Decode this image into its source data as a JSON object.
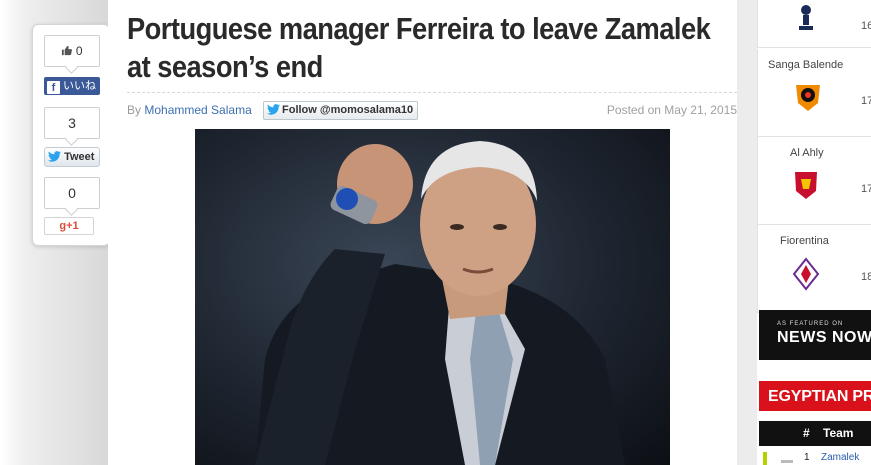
{
  "share": {
    "like_count": "0",
    "facebook_label": "いいね",
    "tweet_count": "3",
    "tweet_label": "Tweet",
    "gplus_count": "0",
    "gplus_label": "+1"
  },
  "article": {
    "title": "Portuguese manager Ferreira to leave Zamalek at season’s end",
    "by_label": "By",
    "author": "Mohammed Salama",
    "follow_label": "Follow @momosalama10",
    "posted": "Posted on May 21, 2015"
  },
  "sidebar": {
    "fixtures": [
      {
        "team": "",
        "time": "16",
        "logo": "tottenham-crest-icon"
      },
      {
        "team": "Sanga Balende",
        "time": "17",
        "logo": "sanga-balende-crest-icon"
      },
      {
        "team": "Al Ahly",
        "time": "17",
        "logo": "al-ahly-crest-icon"
      },
      {
        "team": "Fiorentina",
        "time": "18",
        "logo": "fiorentina-crest-icon"
      }
    ],
    "news_small": "AS FEATURED ON",
    "news_big": "NEWS NOW",
    "league_title": "EGYPTIAN PREMIER",
    "table_headers": {
      "num": "#",
      "team": "Team"
    },
    "table_rows": [
      {
        "num": "1",
        "team": "Zamalek"
      }
    ]
  },
  "colors": {
    "accent_red": "#d9111a",
    "link_blue": "#3c6fb0",
    "facebook_blue": "#3b5998"
  }
}
